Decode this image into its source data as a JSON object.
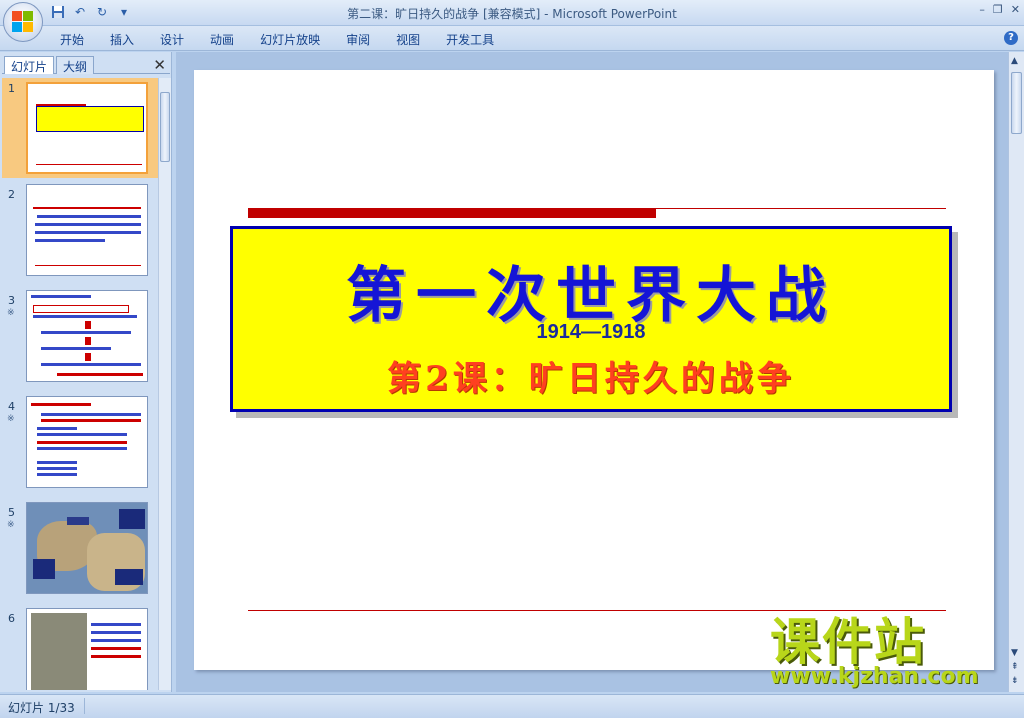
{
  "window": {
    "title": "第二课：旷日持久的战争 [兼容模式] - Microsoft PowerPoint",
    "controls": [
      "–",
      "❐",
      "✕"
    ]
  },
  "quick_access": {
    "icons": [
      "save-icon",
      "undo-icon",
      "redo-icon",
      "customize-icon"
    ]
  },
  "ribbon": {
    "tabs": [
      "开始",
      "插入",
      "设计",
      "动画",
      "幻灯片放映",
      "审阅",
      "视图",
      "开发工具"
    ],
    "help": "?"
  },
  "side_panel": {
    "tab_slides": "幻灯片",
    "tab_outline": "大纲",
    "close": "✕",
    "thumbnails": [
      {
        "num": "1",
        "anim": ""
      },
      {
        "num": "2",
        "anim": ""
      },
      {
        "num": "3",
        "anim": "※"
      },
      {
        "num": "4",
        "anim": "※"
      },
      {
        "num": "5",
        "anim": "※"
      },
      {
        "num": "6",
        "anim": ""
      }
    ]
  },
  "slide": {
    "title": "第一次世界大战",
    "years": "1914—1918",
    "subtitle": "第2课：旷日持久的战争"
  },
  "watermark": {
    "cn": "课件站",
    "url": "www.kjzhan.com"
  },
  "status": {
    "slide_counter": "幻灯片 1/33"
  },
  "colors": {
    "title_blue": "#1515d6",
    "subtitle_red": "#ff4020",
    "box_yellow": "#ffff00",
    "rule_red": "#c00000",
    "watermark_green": "#b8d61a"
  }
}
